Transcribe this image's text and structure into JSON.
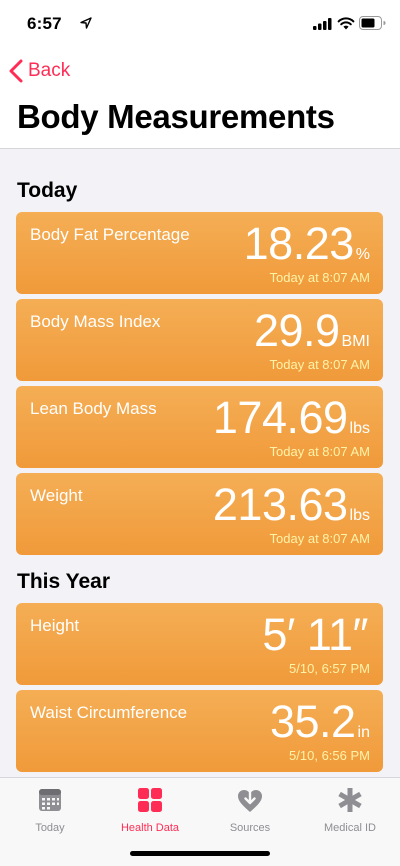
{
  "status_bar": {
    "time": "6:57"
  },
  "nav": {
    "back_label": "Back",
    "title": "Body Measurements"
  },
  "sections": {
    "today": {
      "title": "Today",
      "cards": [
        {
          "label": "Body Fat Percentage",
          "value": "18.23",
          "unit": "%",
          "time": "Today at 8:07 AM"
        },
        {
          "label": "Body Mass Index",
          "value": "29.9",
          "unit": "BMI",
          "time": "Today at 8:07 AM"
        },
        {
          "label": "Lean Body Mass",
          "value": "174.69",
          "unit": "lbs",
          "time": "Today at 8:07 AM"
        },
        {
          "label": "Weight",
          "value": "213.63",
          "unit": "lbs",
          "time": "Today at 8:07 AM"
        }
      ]
    },
    "this_year": {
      "title": "This Year",
      "cards": [
        {
          "label": "Height",
          "value": "5′ 11″",
          "unit": "",
          "time": "5/10, 6:57 PM"
        },
        {
          "label": "Waist Circumference",
          "value": "35.2",
          "unit": "in",
          "time": "5/10, 6:56 PM"
        }
      ]
    }
  },
  "tab_bar": {
    "tabs": [
      {
        "label": "Today",
        "icon": "calendar-icon"
      },
      {
        "label": "Health Data",
        "icon": "grid-icon",
        "active": true
      },
      {
        "label": "Sources",
        "icon": "heart-download-icon"
      },
      {
        "label": "Medical ID",
        "icon": "asterisk-icon"
      }
    ]
  },
  "colors": {
    "accent": "#ff2d55",
    "card_top": "#f5ae55",
    "card_bottom": "#f09a3a",
    "card_time": "#fff3a8"
  }
}
